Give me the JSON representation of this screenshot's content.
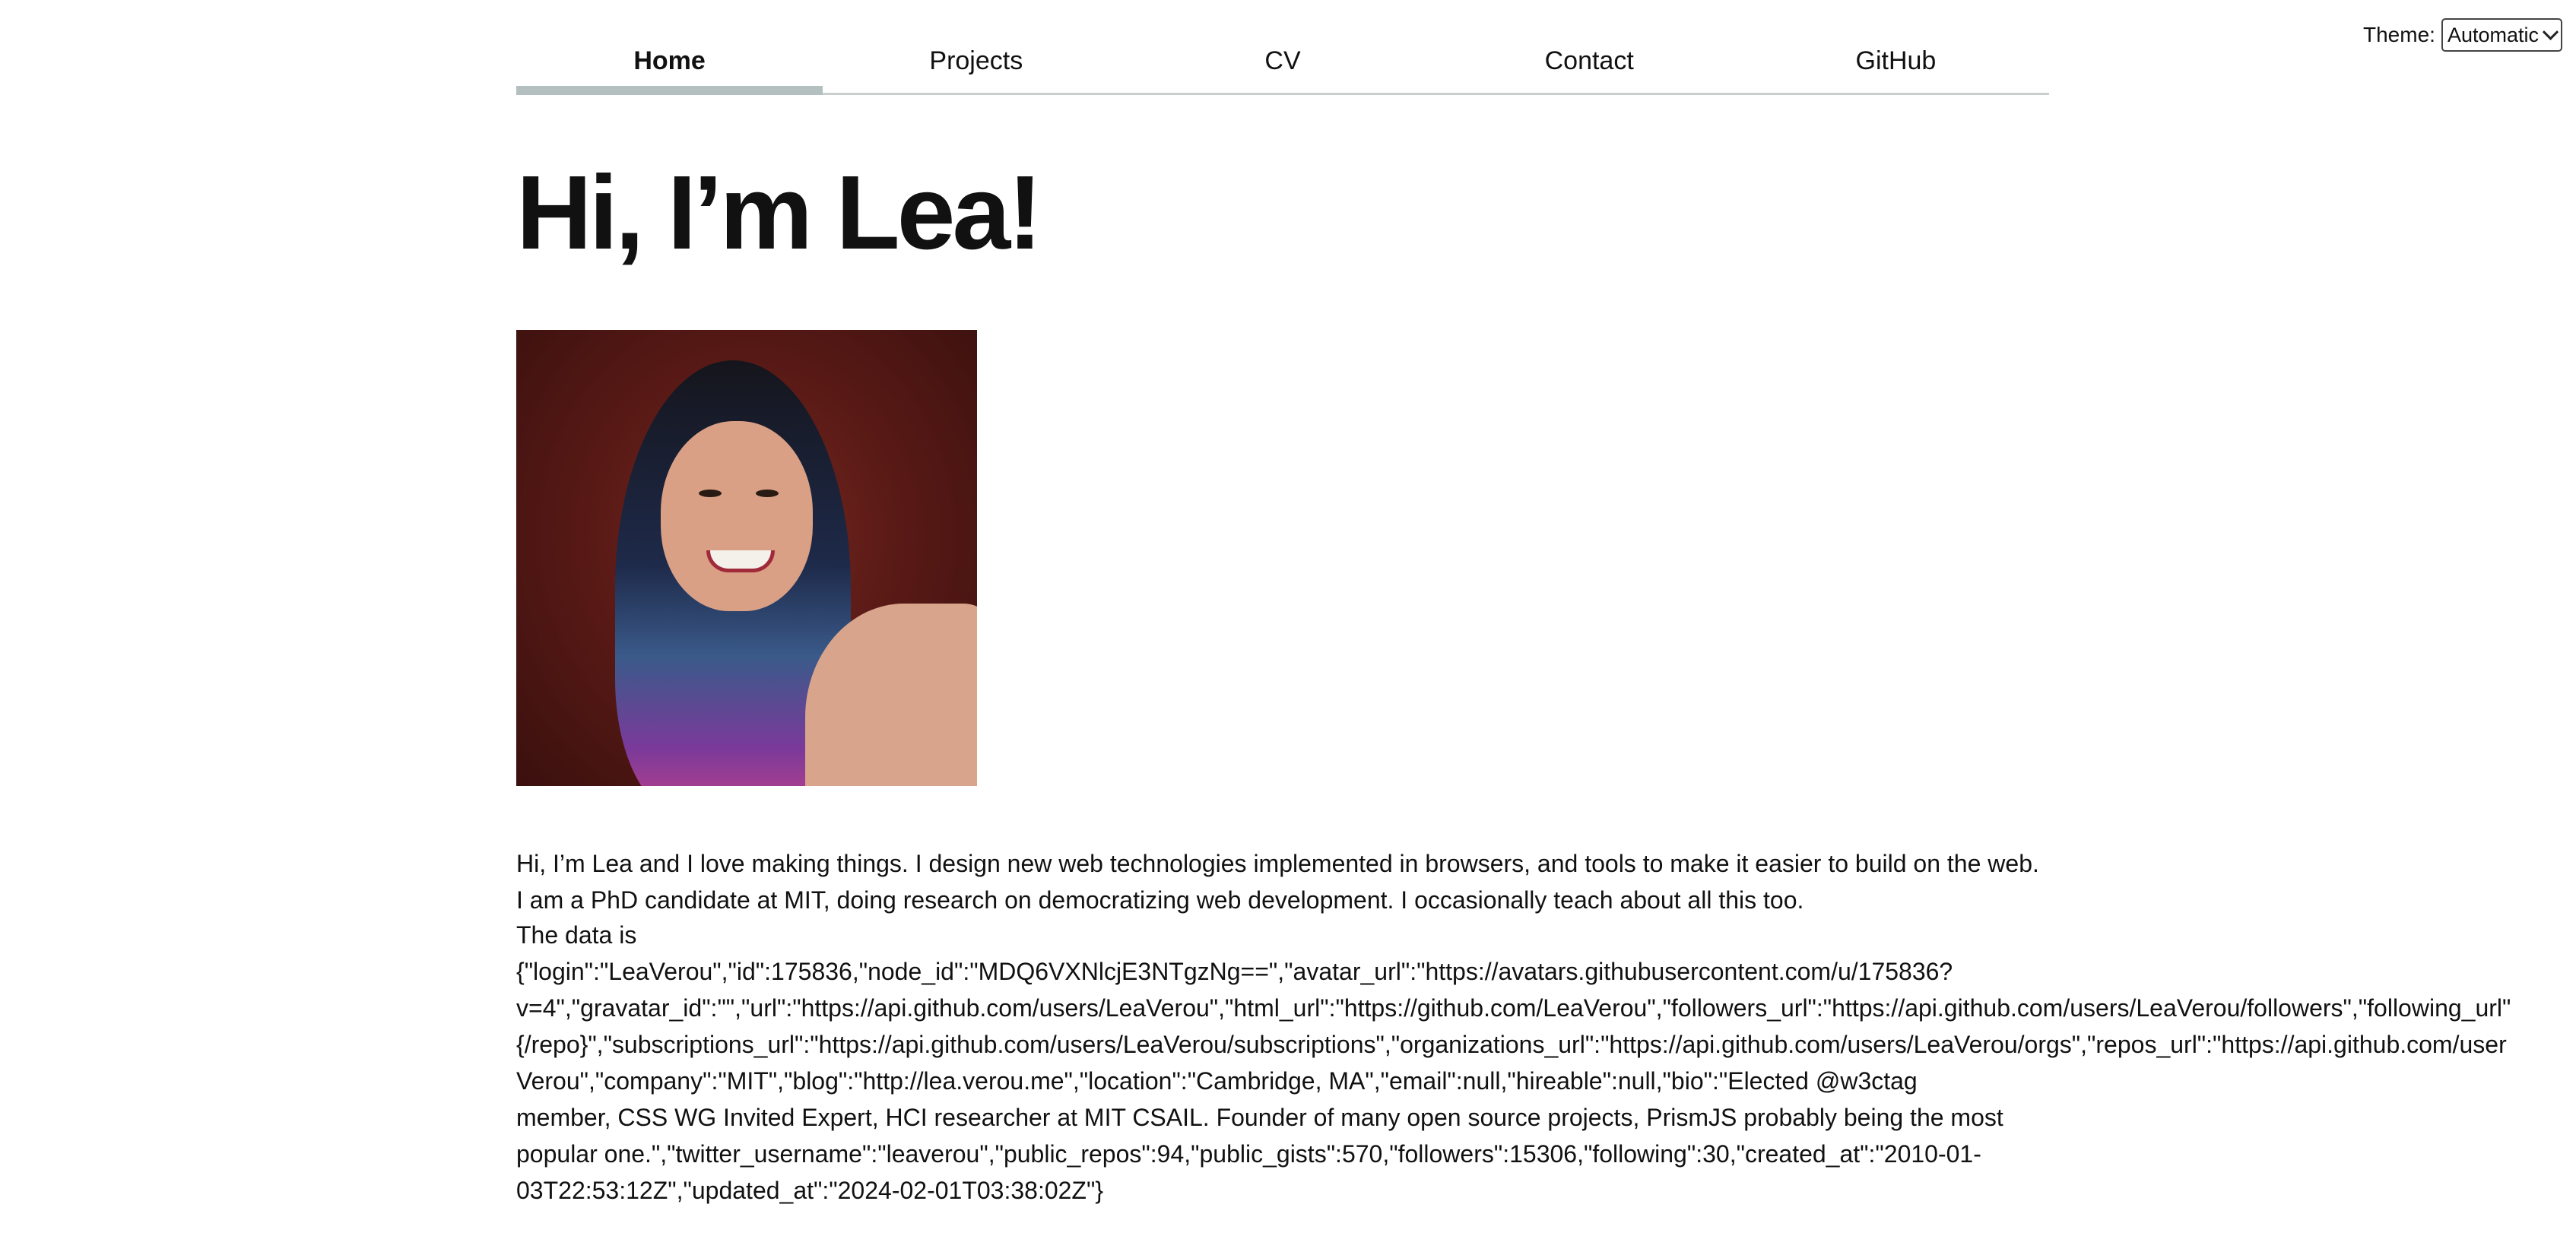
{
  "theme": {
    "label": "Theme:",
    "selected": "Automatic"
  },
  "nav": {
    "items": [
      {
        "label": "Home"
      },
      {
        "label": "Projects"
      },
      {
        "label": "CV"
      },
      {
        "label": "Contact"
      },
      {
        "label": "GitHub"
      }
    ]
  },
  "main": {
    "title": "Hi, I’m Lea!",
    "bio": "Hi, I’m Lea and I love making things. I design new web technologies implemented in browsers, and tools to make it easier to build on the web. I am a PhD candidate at MIT, doing research on democratizing web development. I occasionally teach about all this too.",
    "data_label": "The data is",
    "data_lines": [
      "{\"login\":\"LeaVerou\",\"id\":175836,\"node_id\":\"MDQ6VXNlcjE3NTgzNg==\",\"avatar_url\":\"https://avatars.githubusercontent.com/u/175836?",
      "v=4\",\"gravatar_id\":\"\",\"url\":\"https://api.github.com/users/LeaVerou\",\"html_url\":\"https://github.com/LeaVerou\",\"followers_url\":\"https://api.github.com/users/LeaVerou/followers\",\"following_url\"",
      "{/repo}\",\"subscriptions_url\":\"https://api.github.com/users/LeaVerou/subscriptions\",\"organizations_url\":\"https://api.github.com/users/LeaVerou/orgs\",\"repos_url\":\"https://api.github.com/user",
      "Verou\",\"company\":\"MIT\",\"blog\":\"http://lea.verou.me\",\"location\":\"Cambridge, MA\",\"email\":null,\"hireable\":null,\"bio\":\"Elected @w3ctag",
      "member, CSS WG Invited Expert, HCI researcher at MIT CSAIL. Founder of many open source projects, PrismJS probably being the most",
      "popular one.\",\"twitter_username\":\"leaverou\",\"public_repos\":94,\"public_gists\":570,\"followers\":15306,\"following\":30,\"created_at\":\"2010-01-",
      "03T22:53:12Z\",\"updated_at\":\"2024-02-01T03:38:02Z\"}"
    ]
  }
}
